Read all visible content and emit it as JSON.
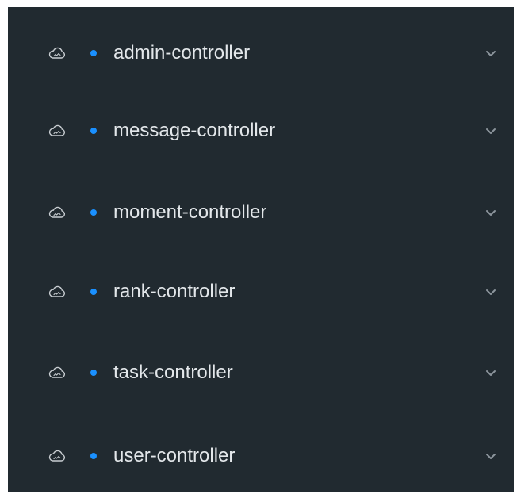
{
  "colors": {
    "panel_bg": "#212a30",
    "text": "#e3e7ea",
    "dot": "#1a90ff",
    "icon": "#c9ced2",
    "chevron": "#8c959c"
  },
  "sidebar": {
    "items": [
      {
        "label": "admin-controller",
        "icon": "cloud-icon",
        "expand_icon": "chevron-down-icon"
      },
      {
        "label": "message-controller",
        "icon": "cloud-icon",
        "expand_icon": "chevron-down-icon"
      },
      {
        "label": "moment-controller",
        "icon": "cloud-icon",
        "expand_icon": "chevron-down-icon"
      },
      {
        "label": "rank-controller",
        "icon": "cloud-icon",
        "expand_icon": "chevron-down-icon"
      },
      {
        "label": "task-controller",
        "icon": "cloud-icon",
        "expand_icon": "chevron-down-icon"
      },
      {
        "label": "user-controller",
        "icon": "cloud-icon",
        "expand_icon": "chevron-down-icon"
      }
    ]
  }
}
